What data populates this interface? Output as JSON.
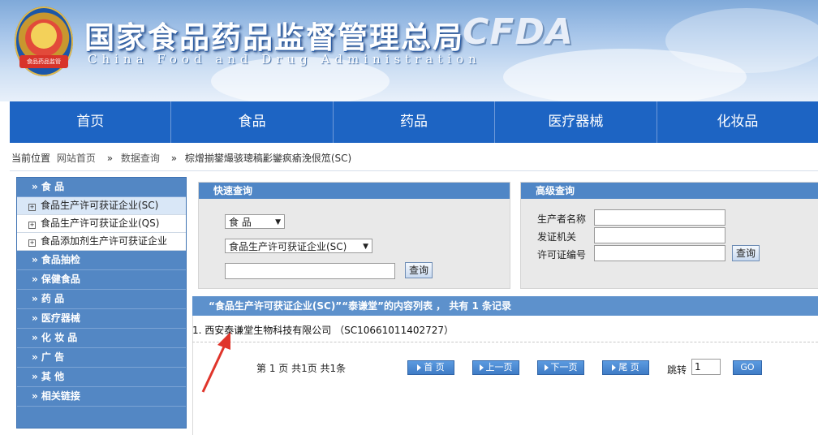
{
  "header": {
    "title": "国家食品药品监督管理总局",
    "subtitle_en": "China Food and Drug Administration",
    "logo_text": "CFDA",
    "emblem_caption": "食品药品监管"
  },
  "nav": [
    "首页",
    "食品",
    "药品",
    "医疗器械",
    "化妆品"
  ],
  "breadcrumb": {
    "label": "当前位置",
    "items": [
      "网站首页",
      "数据查询",
      "棕熷揃鐢熶骇璁稿彲鑾疯瘉浼佷笟(SC)"
    ],
    "separator": "»"
  },
  "sidebar": {
    "food_header": "» 食    品",
    "sub_items": [
      "食品生产许可获证企业(SC)",
      "食品生产许可获证企业(QS)",
      "食品添加剂生产许可获证企业"
    ],
    "sections": [
      "» 食品抽检",
      "» 保健食品",
      "» 药    品",
      "» 医疗器械",
      "» 化 妆 品",
      "» 广    告",
      "» 其    他",
      "» 相关链接"
    ]
  },
  "quick_search": {
    "title": "快速查询",
    "category_select": "食    品",
    "type_select": "食品生产许可获证企业(SC)",
    "keyword_value": "",
    "button": "查询"
  },
  "advanced_search": {
    "title": "高级查询",
    "fields": [
      {
        "label": "生产者名称",
        "value": ""
      },
      {
        "label": "发证机关",
        "value": ""
      },
      {
        "label": "许可证编号",
        "value": ""
      }
    ],
    "button": "查询"
  },
  "results": {
    "header": "“食品生产许可获证企业(SC)”“泰谦堂”的内容列表 ， 共有 1 条记录",
    "rows": [
      {
        "index": "1.",
        "name": "西安泰谦堂生物科技有限公司",
        "code": "（SC10661011402727）"
      }
    ]
  },
  "pager": {
    "info": "第 1 页 共1页 共1条",
    "first": "首 页",
    "prev": "上一页",
    "next": "下一页",
    "last": "尾 页",
    "jump_label": "跳转",
    "jump_value": "1",
    "go": "GO"
  },
  "colors": {
    "nav_bg": "#1d64c3",
    "panel_header": "#4f86c6",
    "annotation_arrow": "#e0352b"
  }
}
